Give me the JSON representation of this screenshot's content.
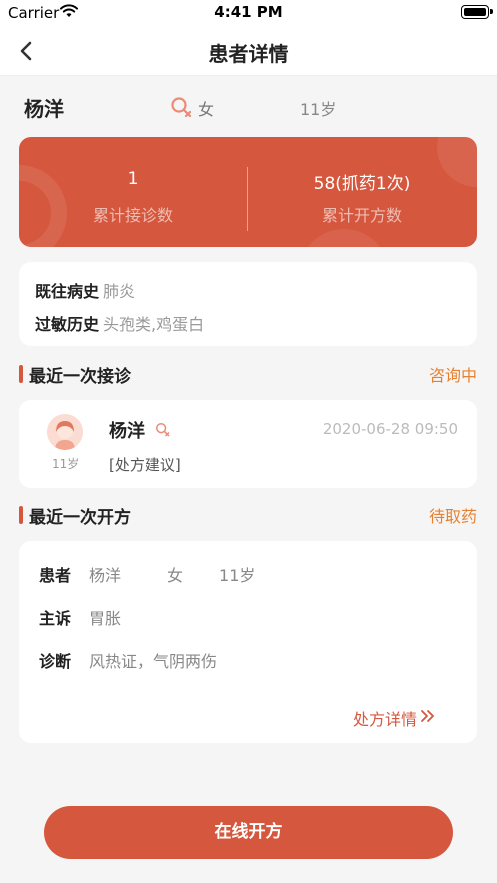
{
  "status_bar": {
    "carrier": "Carrier",
    "time": "4:41 PM"
  },
  "nav": {
    "title": "患者详情"
  },
  "patient": {
    "name": "杨洋",
    "gender": "女",
    "age": "11岁"
  },
  "stats": [
    {
      "value": "1",
      "label": "累计接诊数"
    },
    {
      "value": "58(抓药1次)",
      "label": "累计开方数"
    }
  ],
  "history": {
    "past_label": "既往病史",
    "past_value": "肺炎",
    "allergy_label": "过敏历史",
    "allergy_value": "头孢类,鸡蛋白"
  },
  "consult": {
    "section_title": "最近一次接诊",
    "status": "咨询中",
    "name": "杨洋",
    "age": "11岁",
    "time": "2020-06-28 09:50",
    "desc": "[处方建议]"
  },
  "prescription": {
    "section_title": "最近一次开方",
    "status": "待取药",
    "patient_label": "患者",
    "patient_name": "杨洋",
    "patient_gender": "女",
    "patient_age": "11岁",
    "complaint_label": "主诉",
    "complaint_value": "胃胀",
    "diagnosis_label": "诊断",
    "diagnosis_value": "风热证，气阴两伤",
    "detail_link": "处方详情"
  },
  "action": {
    "label": "在线开方"
  },
  "colors": {
    "accent": "#d5573e",
    "status_orange": "#e8812f",
    "background": "#f5f5f5"
  },
  "icons": {
    "back": "chevron-left-icon",
    "gender": "female-icon",
    "wifi": "wifi-icon",
    "battery": "battery-icon",
    "detail": "double-chevron-right-icon"
  }
}
